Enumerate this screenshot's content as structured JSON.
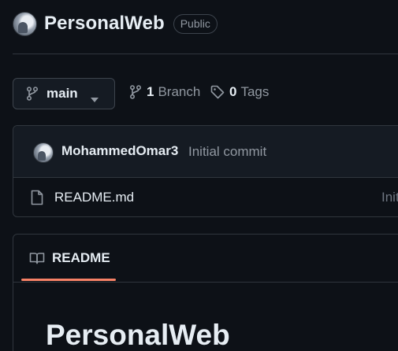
{
  "repo": {
    "name": "PersonalWeb",
    "visibility": "Public"
  },
  "branch_bar": {
    "current_branch": "main",
    "branch_count": "1",
    "branch_label": "Branch",
    "tag_count": "0",
    "tag_label": "Tags"
  },
  "commit": {
    "author": "MohammedOmar3",
    "message": "Initial commit"
  },
  "files": [
    {
      "name": "README.md",
      "last_commit": "Init"
    }
  ],
  "readme": {
    "tab_label": "README",
    "heading": "PersonalWeb"
  },
  "colors": {
    "background": "#0d1117",
    "border": "#30363d",
    "text_primary": "#e6edf3",
    "text_muted": "#9198a1",
    "tab_accent": "#f78166"
  },
  "icons": {
    "branch": "git-branch-icon",
    "caret": "triangle-down-icon",
    "tag": "tag-icon",
    "file": "file-icon",
    "book": "book-icon"
  }
}
